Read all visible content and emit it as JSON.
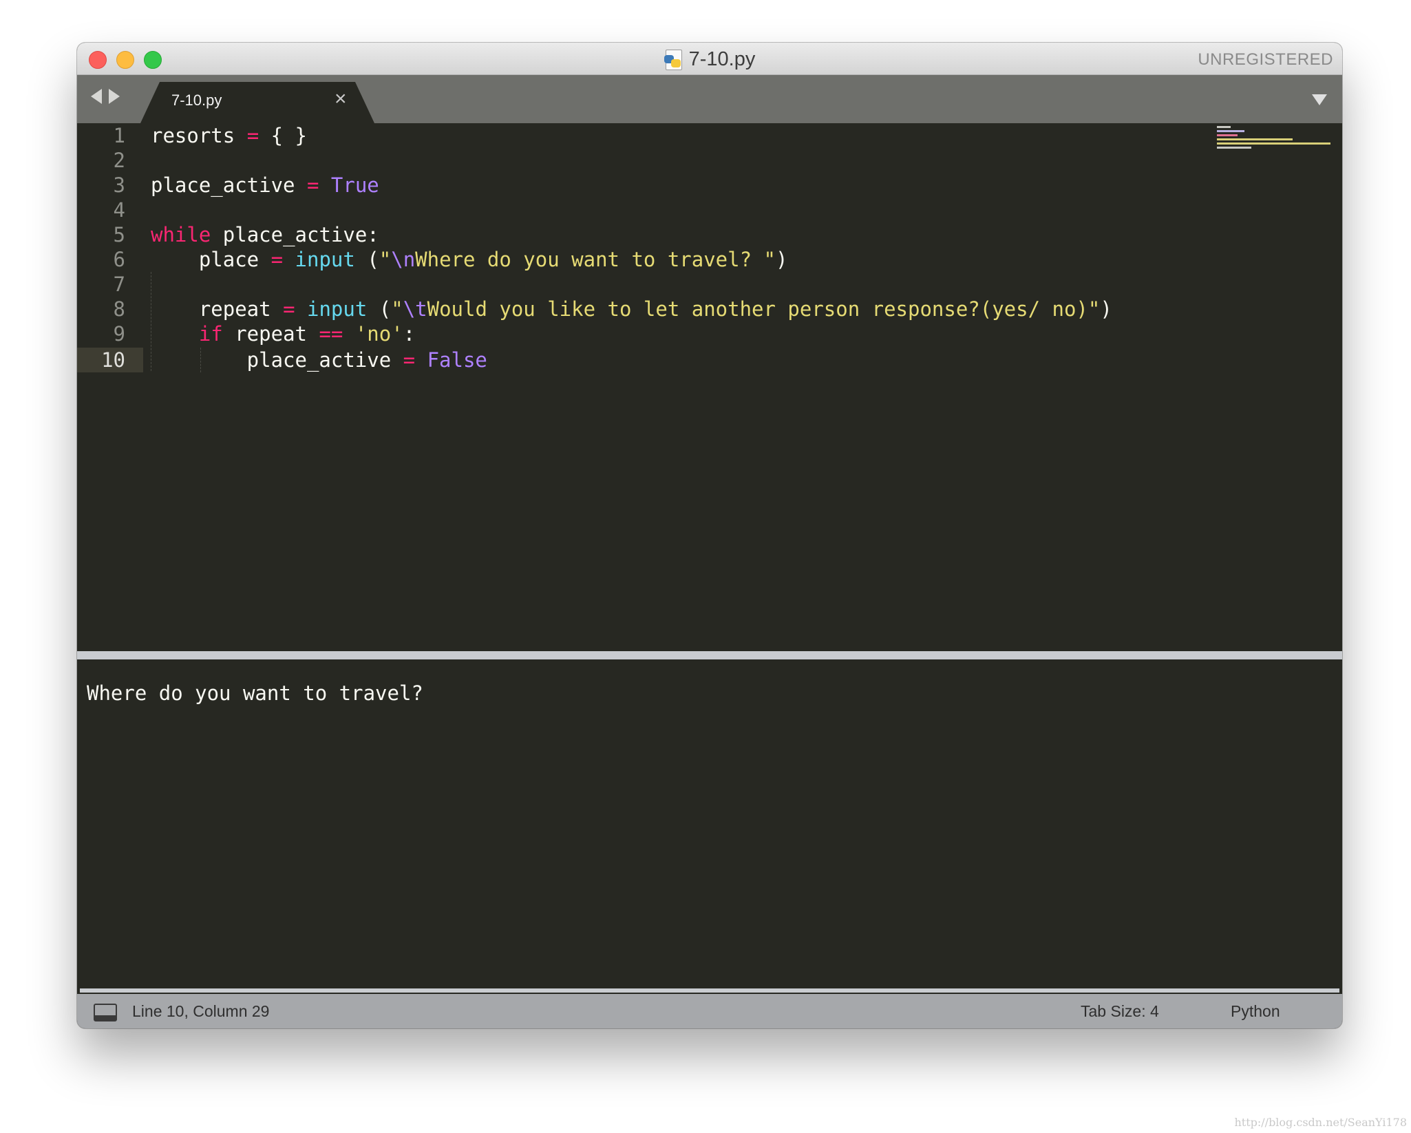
{
  "window": {
    "title": "7-10.py",
    "registration_label": "UNREGISTERED"
  },
  "tabs": [
    {
      "label": "7-10.py",
      "close_glyph": "×"
    }
  ],
  "editor": {
    "line_numbers": [
      "1",
      "2",
      "3",
      "4",
      "5",
      "6",
      "7",
      "8",
      "9",
      "10"
    ],
    "current_line": 10,
    "lines": [
      "resorts = { }",
      "",
      "place_active = True",
      "",
      "while place_active:",
      "    place = input (\"\\nWhere do you want to travel? \")",
      "",
      "    repeat = input (\"\\tWould you like to let another person response?(yes/ no)\")",
      "    if repeat == 'no':",
      "        place_active = False"
    ]
  },
  "output": {
    "text": "Where do you want to travel?"
  },
  "status": {
    "position": "Line 10, Column 29",
    "tab_size": "Tab Size: 4",
    "syntax": "Python"
  },
  "watermark": "http://blog.csdn.net/SeanYi178",
  "colors": {
    "background": "#272822",
    "keyword": "#f92672",
    "builtin": "#66d9ef",
    "constant": "#ae81ff",
    "string": "#e6db74",
    "text": "#f8f8f2"
  },
  "icons": [
    "close-button-icon",
    "minimize-button-icon",
    "zoom-button-icon",
    "python-file-icon",
    "back-arrow-icon",
    "forward-arrow-icon",
    "tab-close-icon",
    "tab-menu-icon",
    "panel-toggle-icon"
  ]
}
